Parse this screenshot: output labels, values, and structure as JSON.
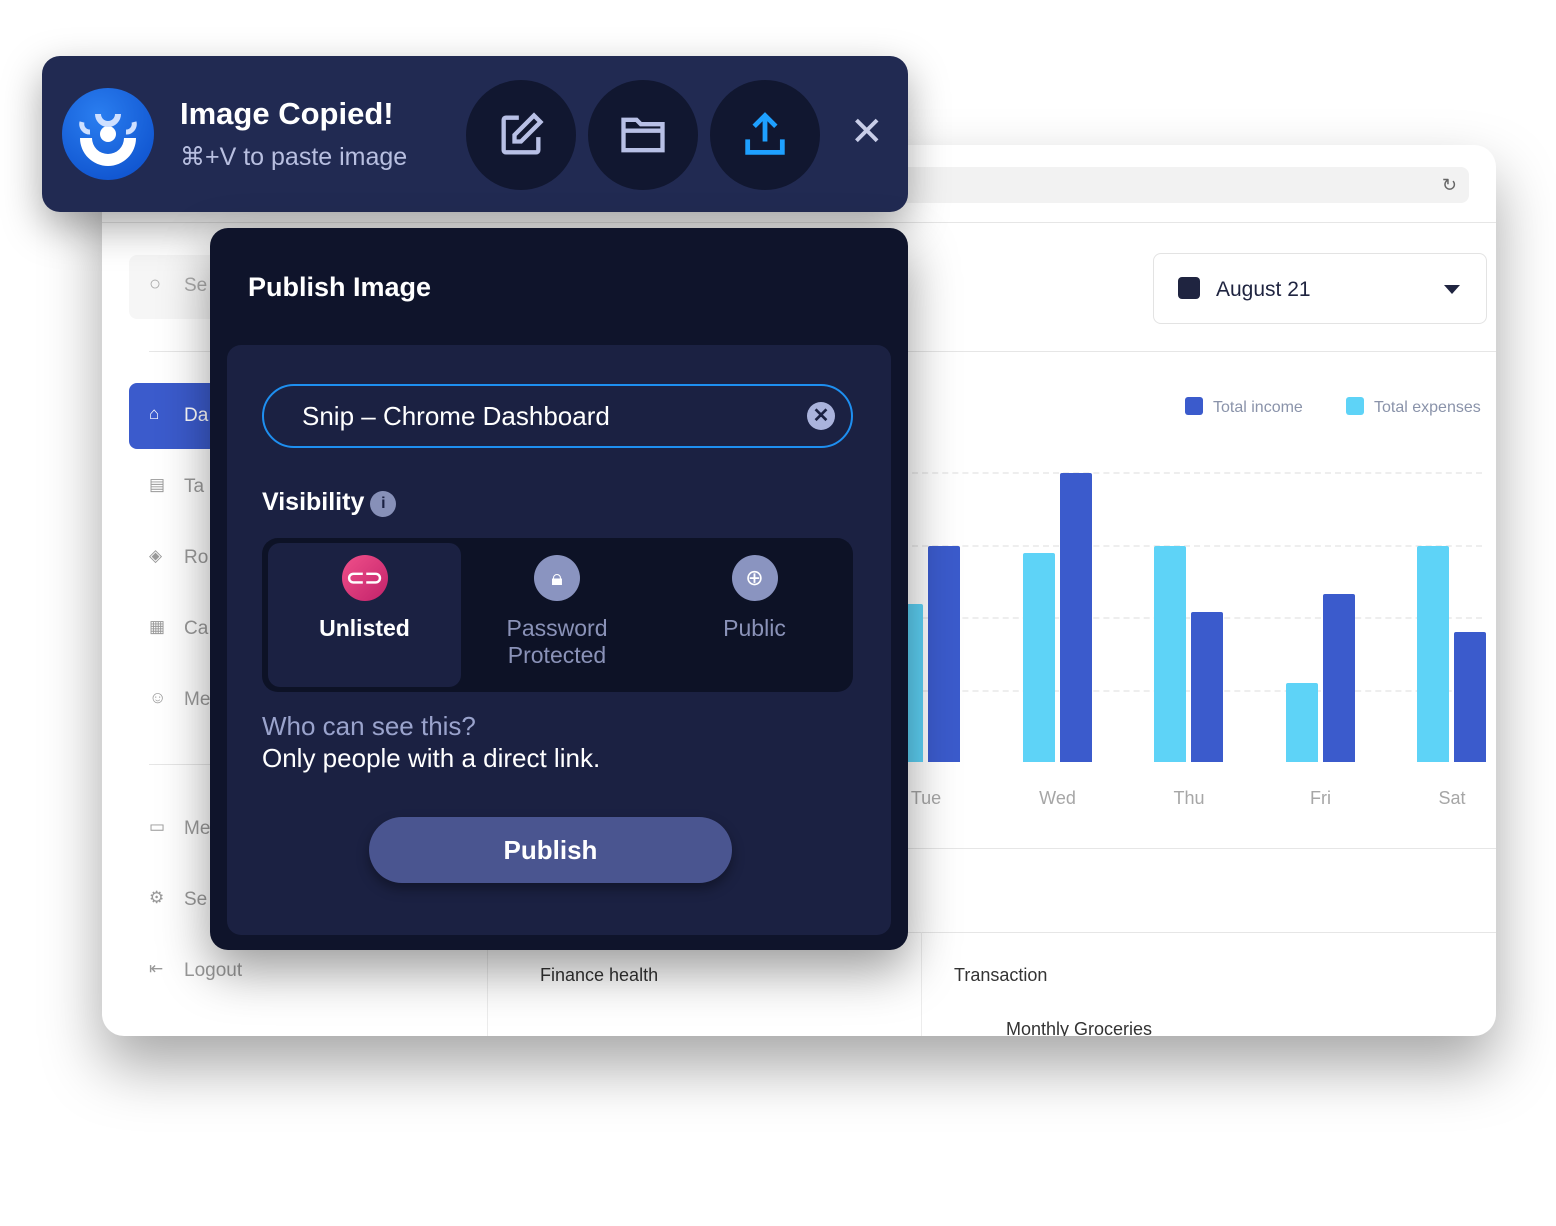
{
  "toast": {
    "title": "Image Copied!",
    "subtitle": "⌘+V to paste image",
    "actions": [
      "edit",
      "open-folder",
      "upload"
    ]
  },
  "browser": {
    "reload_icon": "reload-icon"
  },
  "sidebar": {
    "search_placeholder": "Se",
    "items": [
      {
        "label": "Da",
        "icon": "home-icon",
        "active": true
      },
      {
        "label": "Ta",
        "icon": "clipboard-icon"
      },
      {
        "label": "Ro",
        "icon": "box-icon"
      },
      {
        "label": "Ca",
        "icon": "calendar-icon"
      },
      {
        "label": "Me",
        "icon": "member-icon"
      }
    ],
    "bottom": [
      {
        "label": "Me",
        "icon": "message-icon"
      },
      {
        "label": "Se",
        "icon": "gear-icon"
      },
      {
        "label": "Logout",
        "icon": "logout-icon"
      }
    ]
  },
  "date_picker": {
    "value": "August 21"
  },
  "sections": {
    "finance": "Finance health",
    "transaction": "Transaction",
    "transaction_item": "Monthly Groceries"
  },
  "chart_data": {
    "type": "bar",
    "categories": [
      "Tue",
      "Wed",
      "Thu",
      "Fri",
      "Sat"
    ],
    "series": [
      {
        "name": "Total income",
        "color": "#3b5bcc",
        "values": [
          2.98,
          3.99,
          2.07,
          2.32,
          1.79
        ]
      },
      {
        "name": "Total expenses",
        "color": "#5ed3f7",
        "values": [
          2.18,
          2.88,
          2.98,
          1.09,
          2.98
        ]
      }
    ],
    "ylim": [
      0,
      4
    ],
    "grid": true,
    "legend": "top-right"
  },
  "publish": {
    "title": "Publish Image",
    "name_value": "Snip – Chrome Dashboard",
    "visibility_label": "Visibility",
    "options": [
      {
        "label": "Unlisted",
        "selected": true
      },
      {
        "label": "Password Protected"
      },
      {
        "label": "Public"
      }
    ],
    "help_q": "Who can see this?",
    "help_a": "Only people with a direct link.",
    "button": "Publish"
  }
}
